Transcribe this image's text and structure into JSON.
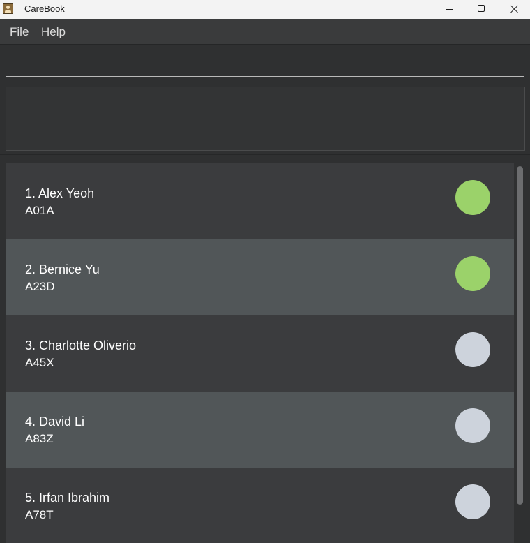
{
  "window": {
    "title": "CareBook"
  },
  "menu": {
    "file": "File",
    "help": "Help"
  },
  "command_box": {
    "value": "",
    "placeholder": ""
  },
  "result_display": {
    "text": ""
  },
  "persons": [
    {
      "name": "1. Alex Yeoh",
      "id": "A01A",
      "status": "green"
    },
    {
      "name": "2. Bernice Yu",
      "id": "A23D",
      "status": "green"
    },
    {
      "name": "3. Charlotte Oliverio",
      "id": "A45X",
      "status": "grey"
    },
    {
      "name": "4. David Li",
      "id": "A83Z",
      "status": "grey"
    },
    {
      "name": "5. Irfan Ibrahim",
      "id": "A78T",
      "status": "grey"
    }
  ],
  "colors": {
    "status_green": "#9bd26a",
    "status_grey": "#cdd3dc"
  }
}
